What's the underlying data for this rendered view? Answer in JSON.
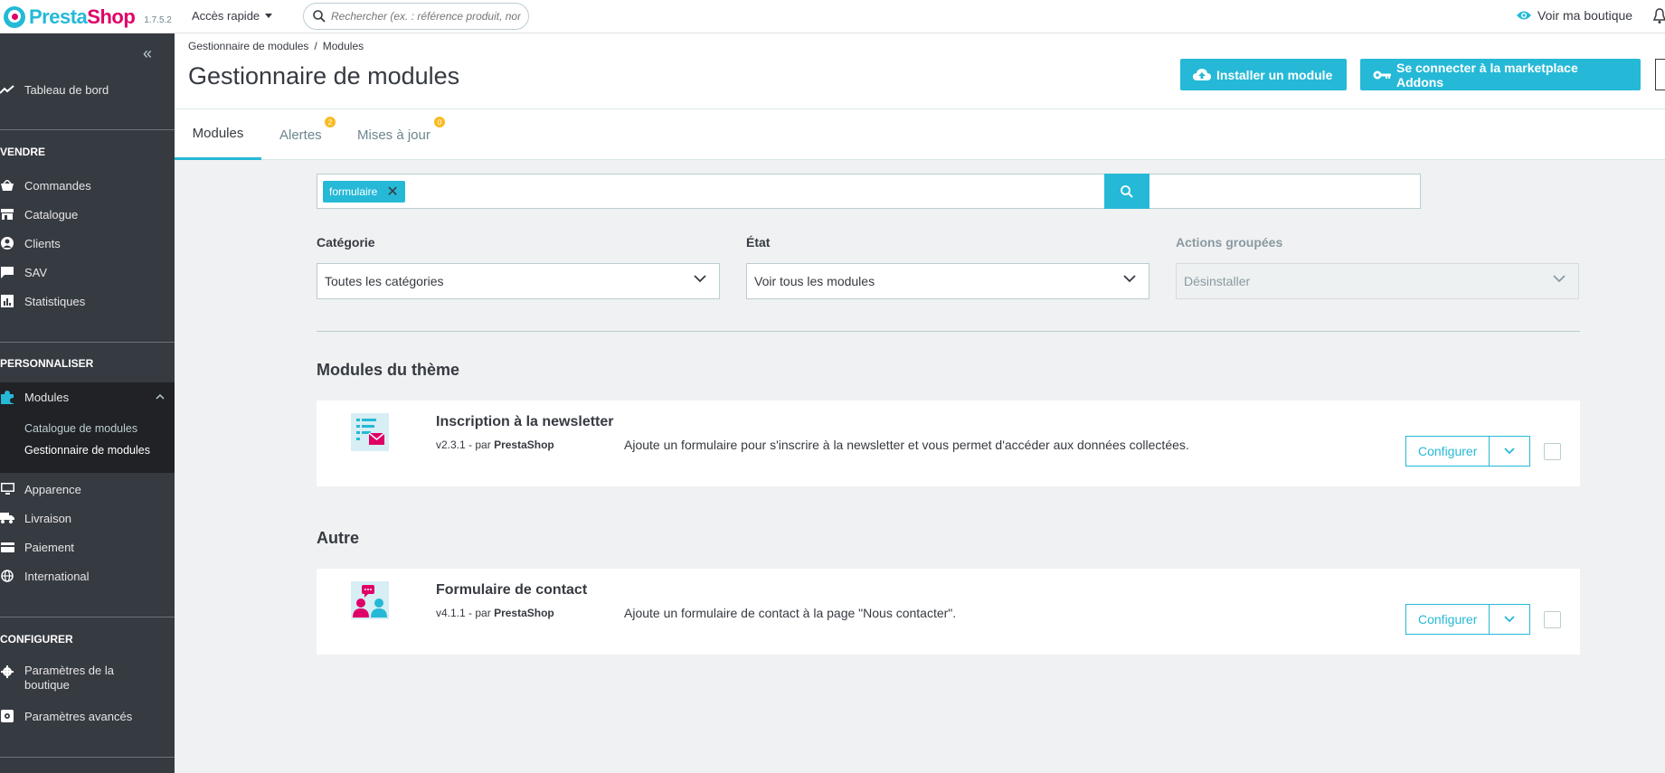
{
  "header": {
    "brand_presta": "Presta",
    "brand_shop": "Shop",
    "version": "1.7.5.2",
    "quick_access": "Accès rapide",
    "search_placeholder": "Rechercher (ex. : référence produit, nom",
    "view_shop": "Voir ma boutique"
  },
  "sidebar": {
    "dashboard": "Tableau de bord",
    "sections": {
      "sell": "VENDRE",
      "customize": "PERSONNALISER",
      "configure": "CONFIGURER"
    },
    "sell_items": [
      "Commandes",
      "Catalogue",
      "Clients",
      "SAV",
      "Statistiques"
    ],
    "modules": "Modules",
    "modules_sub": [
      "Catalogue de modules",
      "Gestionnaire de modules"
    ],
    "customize_items": [
      "Apparence",
      "Livraison",
      "Paiement",
      "International"
    ],
    "configure_items": [
      "Paramètres de la boutique",
      "Paramètres avancés"
    ]
  },
  "page": {
    "breadcrumb": [
      "Gestionnaire de modules",
      "Modules"
    ],
    "breadcrumb_sep": "/",
    "title": "Gestionnaire de modules",
    "install_button": "Installer un module",
    "marketplace_button": "Se connecter à la marketplace Addons"
  },
  "tabs": [
    {
      "label": "Modules",
      "badge": null
    },
    {
      "label": "Alertes",
      "badge": "2"
    },
    {
      "label": "Mises à jour",
      "badge": "0"
    }
  ],
  "search": {
    "chip": "formulaire"
  },
  "filters": {
    "category_label": "Catégorie",
    "category_value": "Toutes les catégories",
    "state_label": "État",
    "state_value": "Voir tous les modules",
    "bulk_label": "Actions groupées",
    "bulk_value": "Désinstaller"
  },
  "sections": [
    {
      "title": "Modules du thème",
      "module": {
        "name": "Inscription à la newsletter",
        "version": "v2.3.1",
        "by": "- par",
        "author": "PrestaShop",
        "description": "Ajoute un formulaire pour s'inscrire à la newsletter et vous permet d'accéder aux données collectées.",
        "configure": "Configurer"
      }
    },
    {
      "title": "Autre",
      "module": {
        "name": "Formulaire de contact",
        "version": "v4.1.1",
        "by": "- par",
        "author": "PrestaShop",
        "description": "Ajoute un formulaire de contact à la page \"Nous contacter\".",
        "configure": "Configurer"
      }
    }
  ],
  "colors": {
    "accent": "#25b9d7",
    "brand_pink": "#df0067",
    "sidebar": "#363a41",
    "badge": "#fbbb22"
  }
}
